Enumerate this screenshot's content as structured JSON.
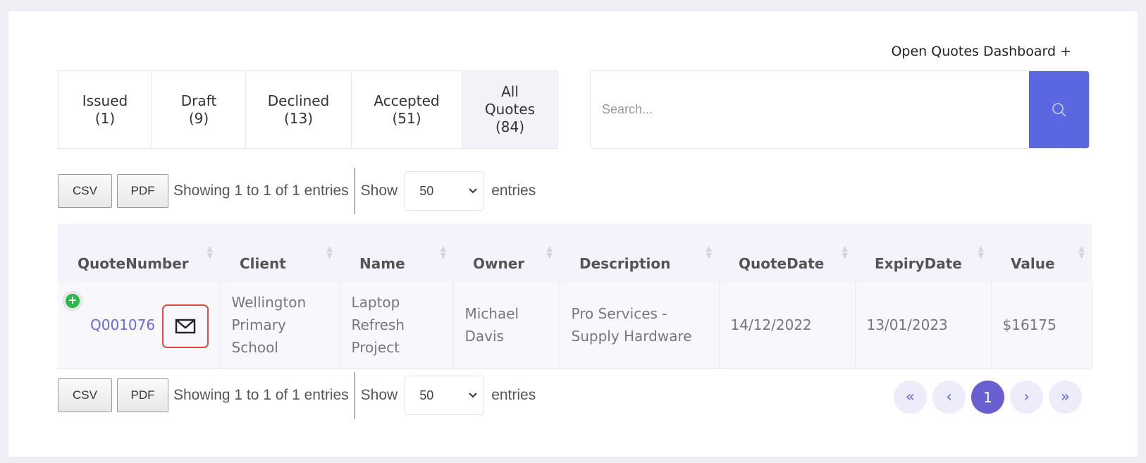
{
  "header": {
    "dashboard_link": "Open Quotes Dashboard +"
  },
  "tabs": [
    {
      "label": "Issued",
      "count": "(1)"
    },
    {
      "label": "Draft",
      "count": "(9)"
    },
    {
      "label": "Declined",
      "count": "(13)"
    },
    {
      "label": "Accepted",
      "count": "(51)"
    },
    {
      "label": "All",
      "label2": "Quotes",
      "count": "(84)"
    }
  ],
  "search": {
    "placeholder": "Search..."
  },
  "controls": {
    "csv_label": "CSV",
    "pdf_label": "PDF",
    "info": "Showing 1 to 1 of 1 entries",
    "show_label": "Show",
    "page_size": "50",
    "entries_label": "entries"
  },
  "table": {
    "columns": [
      "QuoteNumber",
      "Client",
      "Name",
      "Owner",
      "Description",
      "QuoteDate",
      "ExpiryDate",
      "Value"
    ],
    "rows": [
      {
        "quote_number": "Q001076",
        "client": "Wellington Primary School",
        "name": "Laptop Refresh Project",
        "owner": "Michael Davis",
        "description": "Pro Services - Supply Hardware",
        "quote_date": "14/12/2022",
        "expiry_date": "13/01/2023",
        "value": "$16175"
      }
    ]
  },
  "pagination": {
    "first": "«",
    "prev": "‹",
    "current": "1",
    "next": "›",
    "last": "»"
  },
  "colors": {
    "accent": "#5a67e0",
    "active_page": "#6a5fd0",
    "link": "#6a6ae0",
    "highlight": "#e04a3c"
  }
}
